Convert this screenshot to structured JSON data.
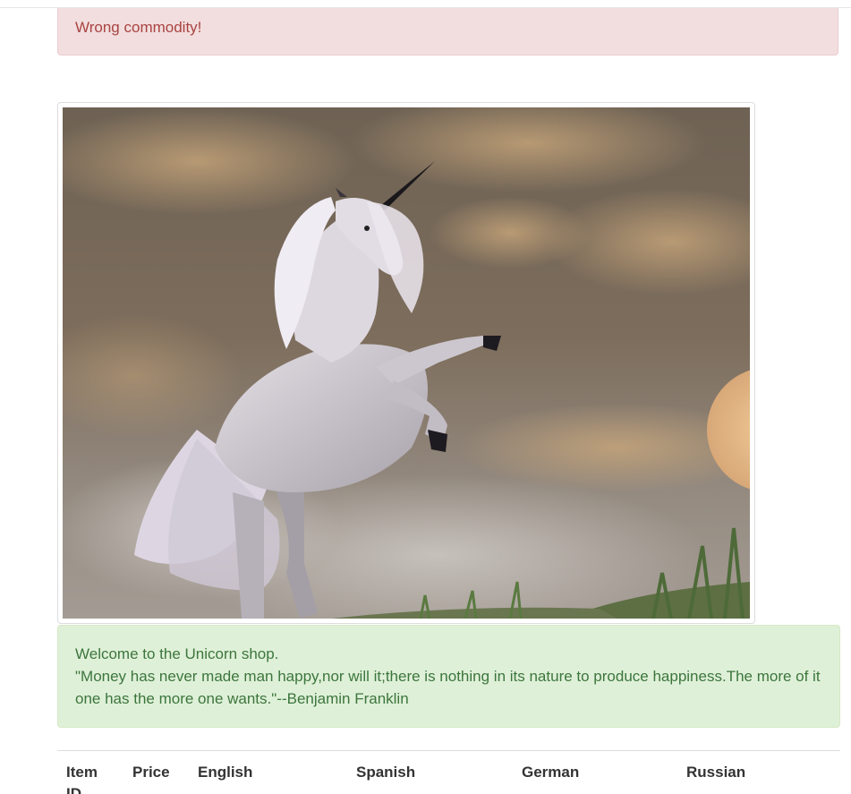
{
  "alert": {
    "message": "Wrong commodity!"
  },
  "hero_image": {
    "subject": "white unicorn rearing against a cloudy sky"
  },
  "welcome": {
    "line1": "Welcome to the Unicorn shop.",
    "quote": "\"Money has never made man happy,nor will it;there is nothing in its nature to produce happiness.The more of it one has the more one wants.\"--Benjamin Franklin"
  },
  "table": {
    "headers": [
      "Item ID",
      "Price",
      "English",
      "Spanish",
      "German",
      "Russian"
    ]
  },
  "colors": {
    "danger_bg": "#f2dede",
    "danger_text": "#a94442",
    "success_bg": "#dff0d8",
    "success_text": "#3c763d"
  }
}
